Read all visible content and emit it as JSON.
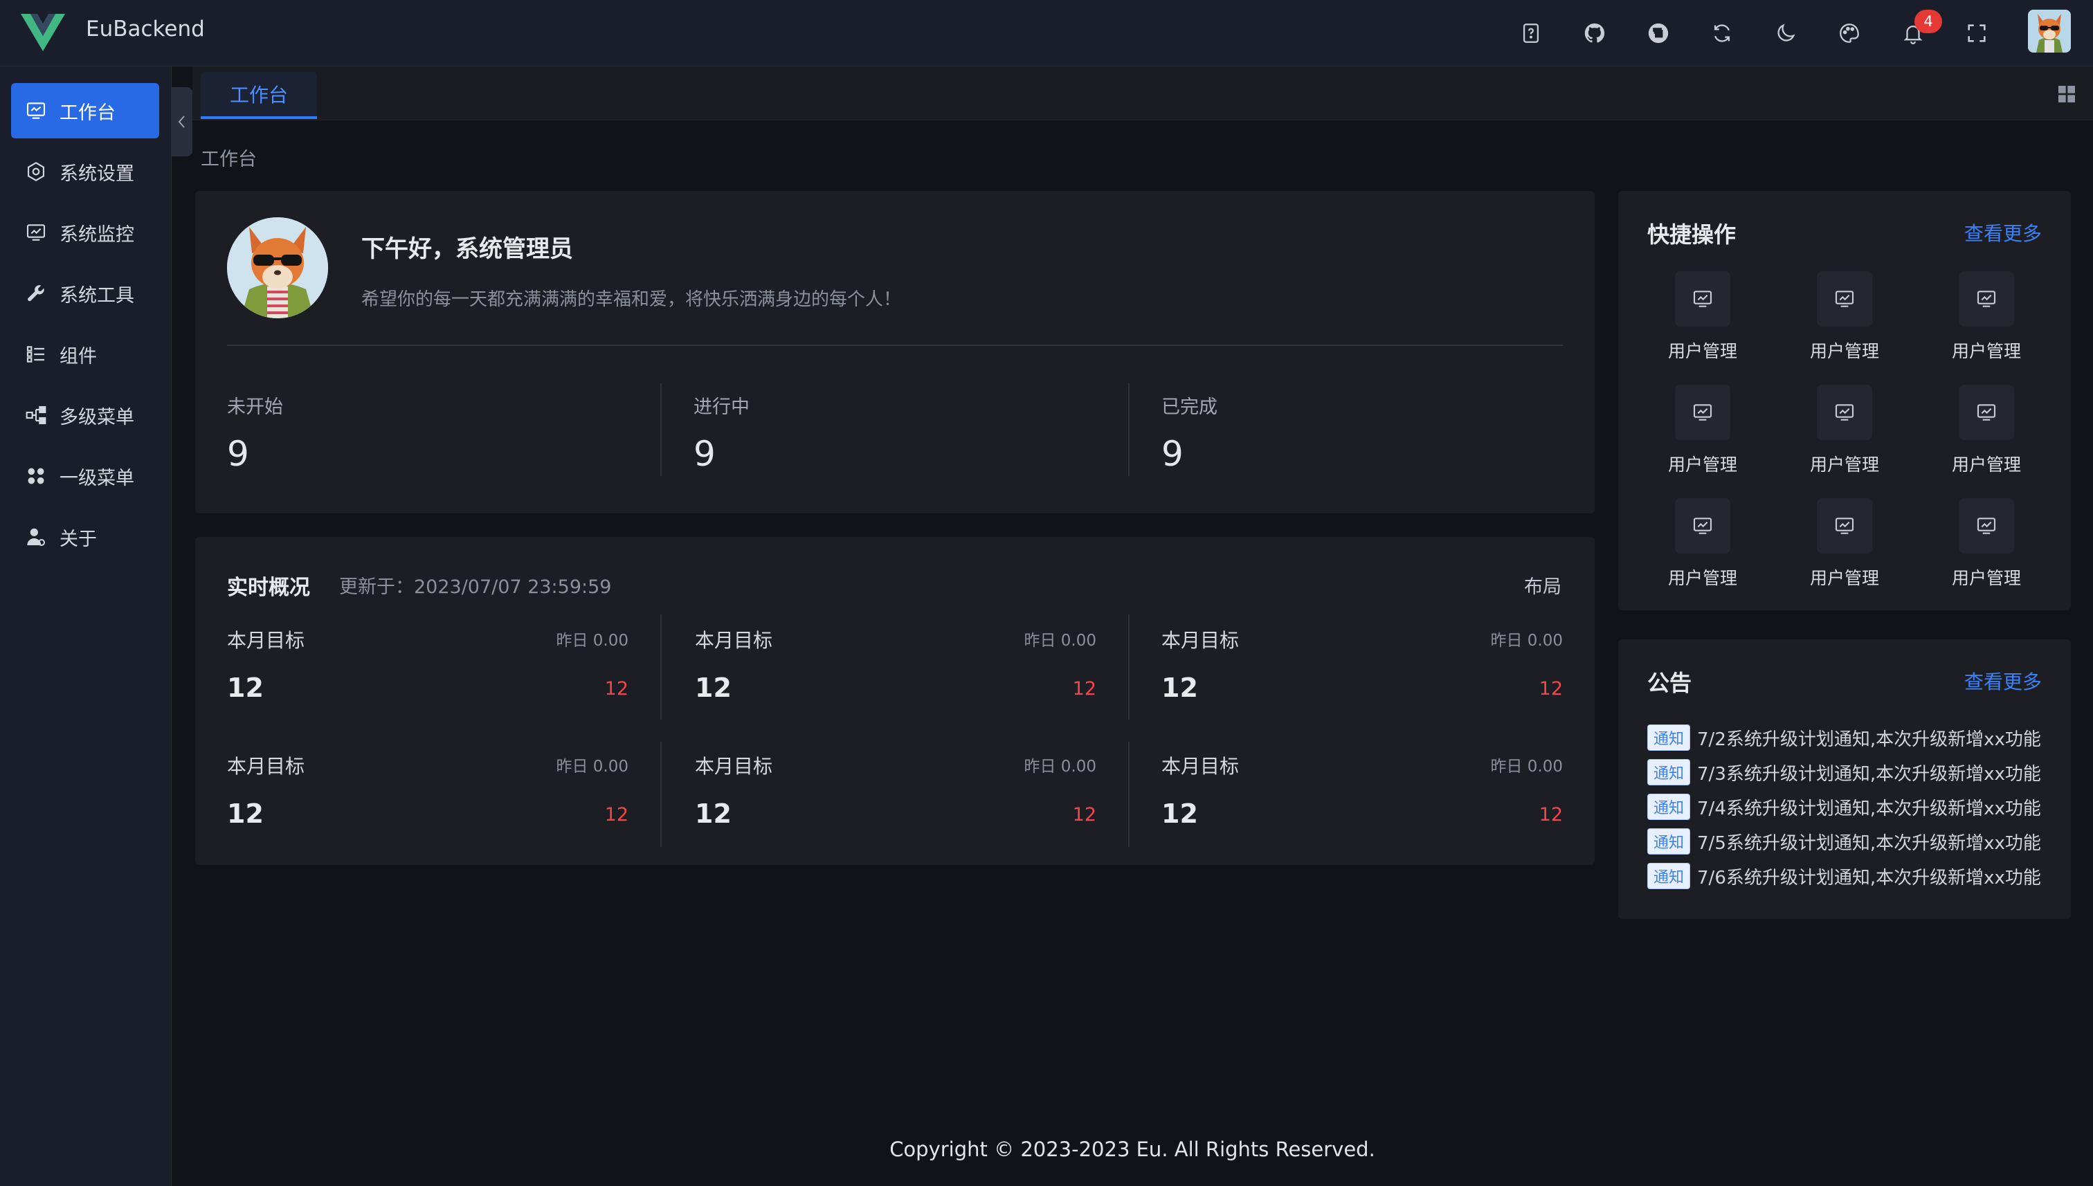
{
  "header": {
    "app_title": "EuBackend",
    "notification_count": "4",
    "icons": [
      "help-icon",
      "github-icon",
      "gitee-icon",
      "refresh-icon",
      "dark-mode-icon",
      "theme-icon",
      "bell-icon",
      "fullscreen-icon"
    ],
    "brand_color": "#41b883",
    "badge_color": "#e53935"
  },
  "sidebar": {
    "items": [
      {
        "label": "工作台",
        "icon": "monitor-icon",
        "active": true
      },
      {
        "label": "系统设置",
        "icon": "gear-icon"
      },
      {
        "label": "系统监控",
        "icon": "monitor-chart-icon"
      },
      {
        "label": "系统工具",
        "icon": "wrench-icon"
      },
      {
        "label": "组件",
        "icon": "list-icon"
      },
      {
        "label": "多级菜单",
        "icon": "tree-icon"
      },
      {
        "label": "一级菜单",
        "icon": "apps-icon"
      },
      {
        "label": "关于",
        "icon": "user-icon"
      }
    ],
    "accent": "#2869e6"
  },
  "tabs": [
    {
      "label": "工作台"
    }
  ],
  "breadcrumb": "工作台",
  "welcome": {
    "greeting": "下午好，系统管理员",
    "subtitle": "希望你的每一天都充满满满的幸福和爱，将快乐洒满身边的每个人！",
    "stats": [
      {
        "label": "未开始",
        "value": "9"
      },
      {
        "label": "进行中",
        "value": "9"
      },
      {
        "label": "已完成",
        "value": "9"
      }
    ]
  },
  "overview": {
    "title": "实时概况",
    "updated": "更新于：2023/07/07 23:59:59",
    "layout_label": "布局",
    "metrics": [
      {
        "label": "本月目标",
        "yesterday": "昨日 0.00",
        "value": "12",
        "delta": "12"
      },
      {
        "label": "本月目标",
        "yesterday": "昨日 0.00",
        "value": "12",
        "delta": "12"
      },
      {
        "label": "本月目标",
        "yesterday": "昨日 0.00",
        "value": "12",
        "delta": "12"
      },
      {
        "label": "本月目标",
        "yesterday": "昨日 0.00",
        "value": "12",
        "delta": "12"
      },
      {
        "label": "本月目标",
        "yesterday": "昨日 0.00",
        "value": "12",
        "delta": "12"
      },
      {
        "label": "本月目标",
        "yesterday": "昨日 0.00",
        "value": "12",
        "delta": "12"
      }
    ],
    "delta_color": "#f0474d"
  },
  "quick_actions": {
    "title": "快捷操作",
    "more": "查看更多",
    "items": [
      {
        "label": "用户管理"
      },
      {
        "label": "用户管理"
      },
      {
        "label": "用户管理"
      },
      {
        "label": "用户管理"
      },
      {
        "label": "用户管理"
      },
      {
        "label": "用户管理"
      },
      {
        "label": "用户管理"
      },
      {
        "label": "用户管理"
      },
      {
        "label": "用户管理"
      }
    ]
  },
  "notices": {
    "title": "公告",
    "more": "查看更多",
    "items": [
      {
        "tag": "通知",
        "text": "7/2系统升级计划通知,本次升级新增xx功能"
      },
      {
        "tag": "通知",
        "text": "7/3系统升级计划通知,本次升级新增xx功能"
      },
      {
        "tag": "通知",
        "text": "7/4系统升级计划通知,本次升级新增xx功能"
      },
      {
        "tag": "通知",
        "text": "7/5系统升级计划通知,本次升级新增xx功能"
      },
      {
        "tag": "通知",
        "text": "7/6系统升级计划通知,本次升级新增xx功能"
      }
    ]
  },
  "footer": "Copyright © 2023-2023 Eu. All Rights Reserved."
}
